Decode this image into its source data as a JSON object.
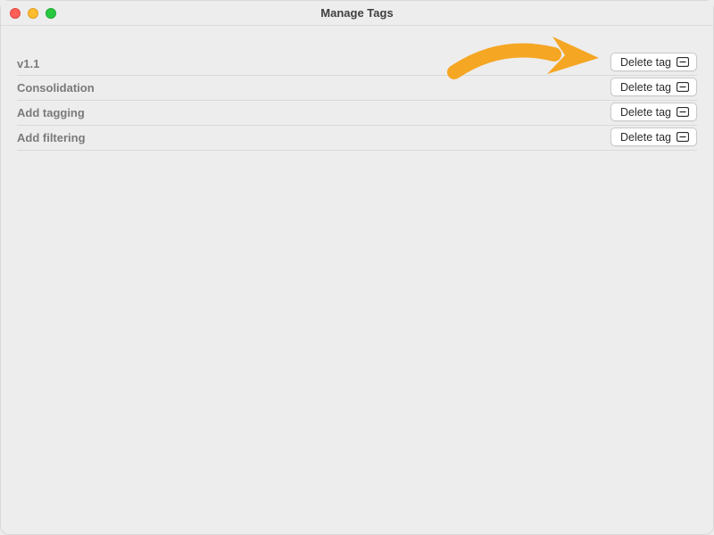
{
  "window": {
    "title": "Manage Tags"
  },
  "tags": [
    {
      "name": "v1.1",
      "delete_label": "Delete tag"
    },
    {
      "name": "Consolidation",
      "delete_label": "Delete tag"
    },
    {
      "name": "Add tagging",
      "delete_label": "Delete tag"
    },
    {
      "name": "Add filtering",
      "delete_label": "Delete tag"
    }
  ]
}
